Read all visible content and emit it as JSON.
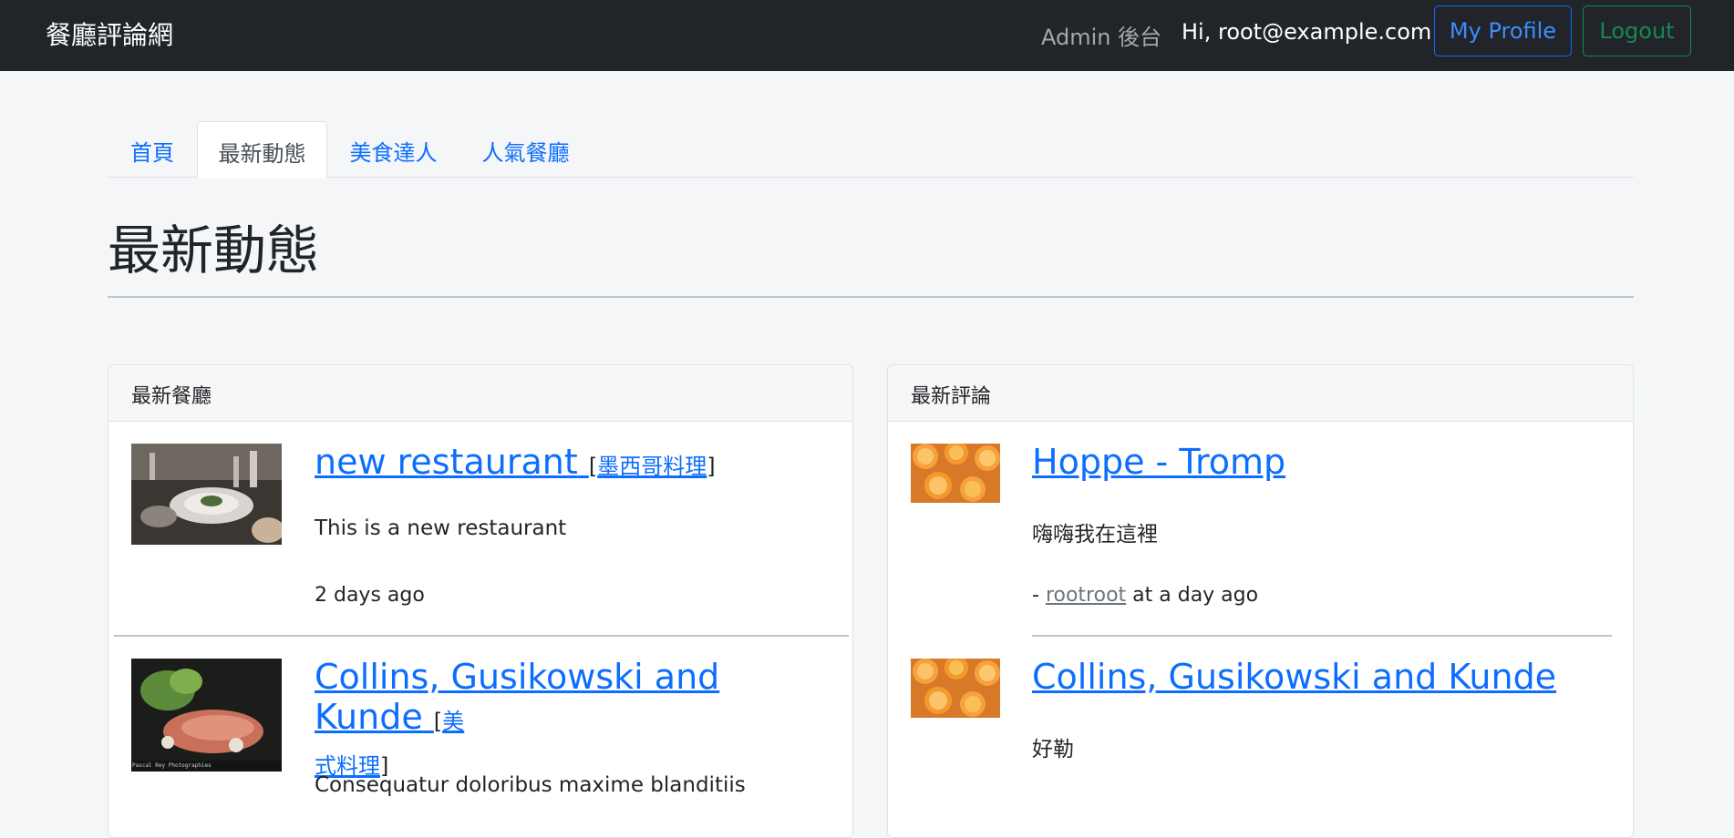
{
  "navbar": {
    "brand": "餐廳評論網",
    "admin_link": "Admin 後台",
    "greeting": "Hi, root@example.com",
    "profile_button": "My Profile",
    "logout_button": "Logout",
    "colors": {
      "bg": "#212529",
      "profile": "#0d6efd",
      "logout": "#198754"
    }
  },
  "tabs": [
    {
      "label": "首頁",
      "active": false
    },
    {
      "label": "最新動態",
      "active": true
    },
    {
      "label": "美食達人",
      "active": false
    },
    {
      "label": "人氣餐廳",
      "active": false
    }
  ],
  "page": {
    "title": "最新動態"
  },
  "latest_restaurants": {
    "header": "最新餐廳",
    "items": [
      {
        "name": "new restaurant",
        "category": "墨西哥料理",
        "description": "This is a new restaurant",
        "time": "2 days ago",
        "image": "dining-table-photo"
      },
      {
        "name": "Collins, Gusikowski and Kunde",
        "category_part1": "美",
        "category_part2": "式料理",
        "description": "Consequatur doloribus maxime blanditiis",
        "image": "salmon-salad-photo",
        "image_caption": "Pascal Rey Photographies"
      }
    ]
  },
  "latest_comments": {
    "header": "最新評論",
    "items": [
      {
        "restaurant": "Hoppe - Tromp",
        "text": "嗨嗨我在這裡",
        "prefix": "- ",
        "user": "rootroot",
        "time_suffix": " at a day ago",
        "image": "oranges-photo"
      },
      {
        "restaurant": "Collins, Gusikowski and Kunde",
        "text": "好勒",
        "image": "oranges-photo"
      }
    ]
  }
}
